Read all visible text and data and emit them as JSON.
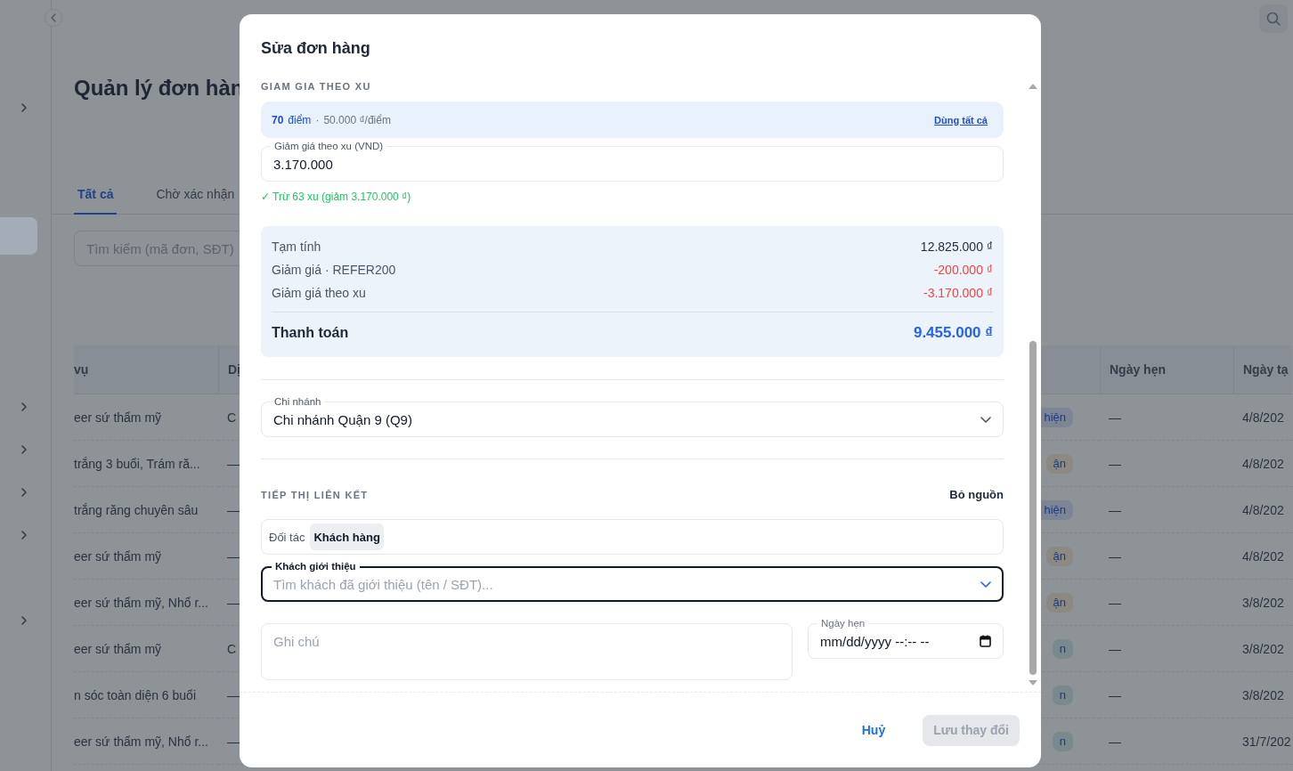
{
  "sidebar": {
    "items": [
      {
        "expandable": true,
        "selected": false
      },
      {
        "expandable": false,
        "selected": false
      },
      {
        "expandable": false,
        "selected": false
      },
      {
        "expandable": false,
        "selected": true
      },
      {
        "expandable": false,
        "selected": false
      },
      {
        "expandable": false,
        "selected": false
      },
      {
        "expandable": false,
        "selected": false
      },
      {
        "expandable": true,
        "selected": false
      },
      {
        "expandable": true,
        "selected": false
      },
      {
        "expandable": true,
        "selected": false
      },
      {
        "expandable": true,
        "selected": false
      },
      {
        "expandable": false,
        "selected": false
      },
      {
        "expandable": true,
        "selected": false
      }
    ]
  },
  "page": {
    "title": "Quản lý đơn hàn",
    "tabs": [
      {
        "label": "Tất cả",
        "selected": true
      },
      {
        "label": "Chờ xác nhận",
        "selected": false
      }
    ],
    "search": {
      "placeholder": "Tìm kiếm (mã đơn, SĐT)"
    }
  },
  "table": {
    "columns": [
      {
        "label": "vụ"
      },
      {
        "label": "Dị"
      },
      {
        "label": "Ngày hẹn"
      },
      {
        "label": "Ngày tạ"
      }
    ],
    "rows": [
      {
        "column_1": "eer sứ thẩm mỹ",
        "column_2": "C",
        "status": {
          "label": "hiện",
          "color": "#7b8595"
        },
        "appointment": "—",
        "created": "4/8/202"
      },
      {
        "column_1": "trắng 3 buổi, Trám ră...",
        "column_2": "—",
        "status": {
          "label": "ận",
          "color": "#8c8982"
        },
        "appointment": "—",
        "created": "4/8/202"
      },
      {
        "column_1": "trắng răng chuyên sâu",
        "column_2": "—",
        "status": {
          "label": "hiện",
          "color": "#7b8595"
        },
        "appointment": "—",
        "created": "4/8/202"
      },
      {
        "column_1": "eer sứ thẩm mỹ",
        "column_2": "—",
        "status": {
          "label": "ận",
          "color": "#8c8982"
        },
        "appointment": "—",
        "created": "4/8/202"
      },
      {
        "column_1": "eer sứ thẩm mỹ, Nhổ r...",
        "column_2": "—",
        "status": {
          "label": "ận",
          "color": "#8c8982"
        },
        "appointment": "—",
        "created": "3/8/202"
      },
      {
        "column_1": "eer sứ thẩm mỹ",
        "column_2": "C",
        "status": {
          "label": "n",
          "color": "#79898e"
        },
        "appointment": "—",
        "created": "3/8/202"
      },
      {
        "column_1": "n sóc toàn diện 6 buổi",
        "column_2": "—",
        "status": {
          "label": "n",
          "color": "#79898e"
        },
        "appointment": "—",
        "created": "3/8/202"
      },
      {
        "column_1": "eer sứ thẩm mỹ, Nhổ r...",
        "column_2": "—",
        "status": {
          "label": "n",
          "color": "#79898e"
        },
        "appointment": "—",
        "created": "31/7/202"
      }
    ]
  },
  "dialog": {
    "title": "Sửa đơn hàng",
    "coin_discount": {
      "heading": "GIAM GIA THEO XU",
      "points": "70",
      "points_unit": "điểm",
      "separator": "·",
      "rate": "50.000 ₫/điểm",
      "use_all": "Dùng tất cả",
      "field": {
        "label": "Giảm giá theo xu (VND)",
        "value": "3.170.000"
      },
      "note": "✓ Trừ 63 xu (giảm 3.170.000 ₫)"
    },
    "summary": {
      "rows": [
        {
          "kind": "normal",
          "label": "Tạm tính",
          "value": "12.825.000 ₫"
        },
        {
          "kind": "discount",
          "label": "Giảm giá · REFER200",
          "value": "-200.000 ₫"
        },
        {
          "kind": "discount",
          "label": "Giảm giá theo xu",
          "value": "-3.170.000 ₫"
        },
        {
          "kind": "total",
          "label": "Thanh toán",
          "value": "9.455.000 ₫"
        }
      ]
    },
    "branch": {
      "label": "Chi nhánh",
      "value": "Chi nhánh Quận 9 (Q9)"
    },
    "affiliate": {
      "heading": "TIẾP THỊ LIÊN KẾT",
      "clear": "Bỏ nguồn",
      "types": [
        {
          "label": "Đối tác",
          "selected": false
        },
        {
          "label": "Khách hàng",
          "selected": true
        }
      ],
      "referrer": {
        "label": "Khách giới thiệu",
        "placeholder": "Tìm khách đã giới thiệu (tên / SĐT)...",
        "focused": true
      }
    },
    "note": {
      "placeholder": "Ghi chú"
    },
    "appointment": {
      "label": "Ngày hẹn",
      "value": "mm/dd/yyyy --:-- --"
    },
    "buttons": [
      {
        "kind": "cancel",
        "label": "Huỷ",
        "disabled": false
      },
      {
        "kind": "primary",
        "label": "Lưu thay đổi",
        "disabled": true
      }
    ]
  }
}
